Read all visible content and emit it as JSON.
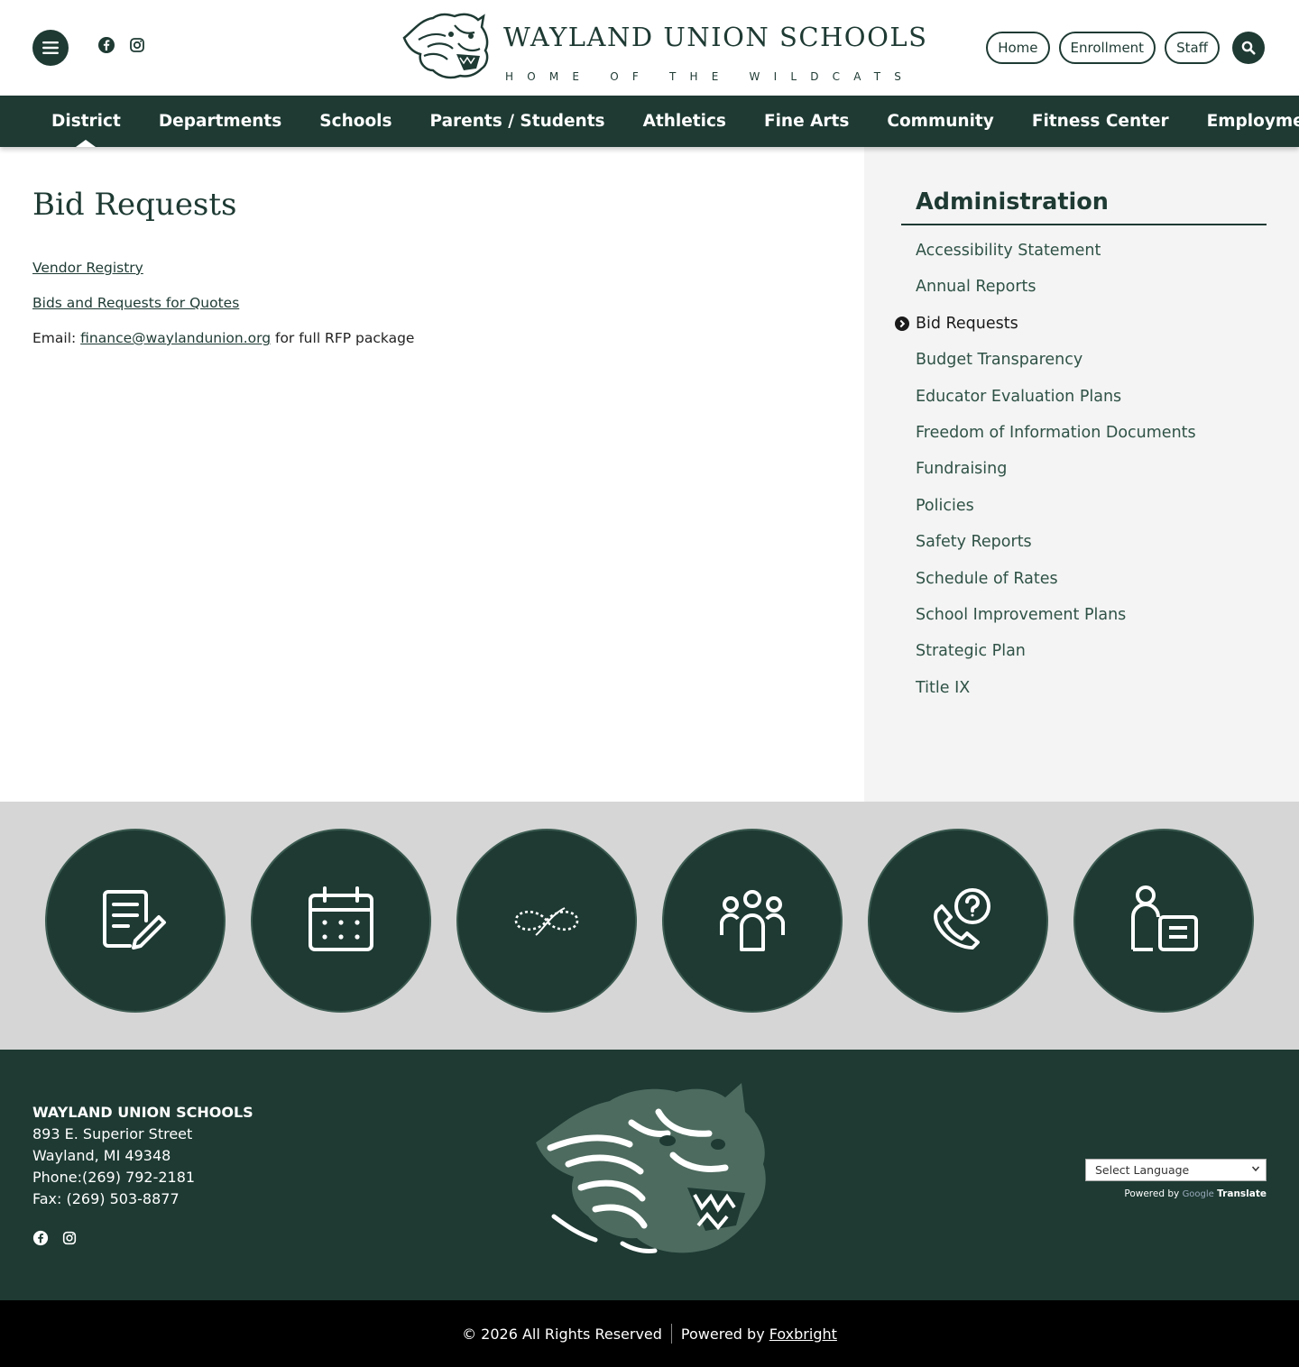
{
  "header": {
    "brand_title": "WAYLAND UNION SCHOOLS",
    "brand_tagline": "HOME OF THE WILDCATS",
    "top_links": [
      "Home",
      "Enrollment",
      "Staff"
    ]
  },
  "nav": {
    "items": [
      "District",
      "Departments",
      "Schools",
      "Parents / Students",
      "Athletics",
      "Fine Arts",
      "Community",
      "Fitness Center",
      "Employment"
    ],
    "active": "District"
  },
  "main": {
    "title": "Bid Requests",
    "links": {
      "vendor_registry": "Vendor Registry",
      "bids_quotes": "Bids and Requests for Quotes"
    },
    "email_prefix": "Email: ",
    "email": "finance@waylandunion.org",
    "email_suffix": " for full RFP package"
  },
  "sidebar": {
    "title": "Administration",
    "items": [
      "Accessibility Statement",
      "Annual Reports",
      "Bid Requests",
      "Budget Transparency",
      "Educator Evaluation Plans",
      "Freedom of Information Documents",
      "Fundraising",
      "Policies",
      "Safety Reports",
      "Schedule of Rates",
      "School Improvement Plans",
      "Strategic Plan",
      "Title IX"
    ],
    "current": "Bid Requests"
  },
  "quick_links": {
    "icons": [
      "document-edit-icon",
      "calendar-icon",
      "infinity-icon",
      "family-icon",
      "phone-help-icon",
      "staff-directory-icon"
    ]
  },
  "footer": {
    "name": "WAYLAND UNION SCHOOLS",
    "address1": "893 E. Superior Street",
    "address2": "Wayland, MI 49348",
    "phone": "Phone:(269) 792-2181",
    "fax": "Fax: (269) 503-8877",
    "translate": {
      "select_label": "Select Language",
      "powered_by": "Powered by",
      "google": "Google",
      "translate": "Translate"
    }
  },
  "bottom": {
    "copyright": "© 2026 All Rights Reserved",
    "powered_by": "Powered by",
    "powered_link": "Foxbright"
  },
  "colors": {
    "brand_green": "#1e3a33",
    "sidebar_bg": "#f4f4f4",
    "quick_bg": "#d6d6d6",
    "bottom_bg": "#000000"
  }
}
